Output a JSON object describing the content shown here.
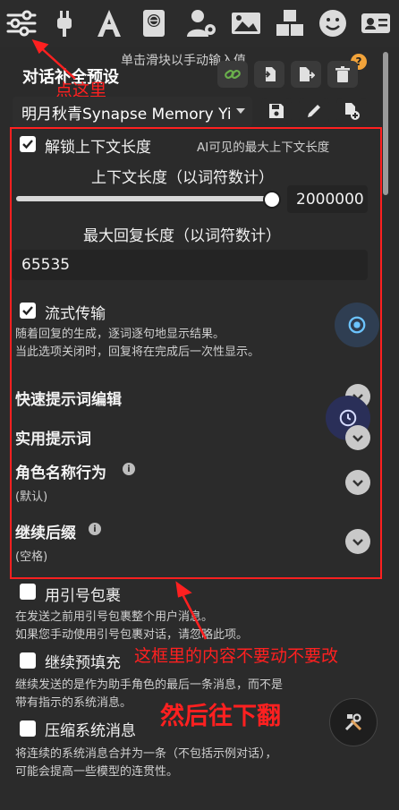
{
  "top_icons": [
    "sliders-icon",
    "plug-icon",
    "font-icon",
    "book-globe-icon",
    "user-gear-icon",
    "image-icon",
    "cubes-icon",
    "smiley-icon",
    "id-card-icon"
  ],
  "hint_text": "单击滑块以手动输入值",
  "preset": {
    "title": "对话补全预设",
    "selected": "明月秋青Synapse Memory Yi"
  },
  "annotations": {
    "click_here": "点这里",
    "box_note": "这框里的内容不要动不要改",
    "scroll_note": "然后往下翻"
  },
  "context": {
    "unlock_label": "解锁上下文长度",
    "unlock_checked": true,
    "ai_visible_label": "AI可见的最大上下文长度",
    "length_label": "上下文长度（以词符数计）",
    "length_value": "2000000",
    "slider_fraction": 1.0,
    "max_reply_label": "最大回复长度（以词符数计）",
    "max_reply_value": "65535"
  },
  "streaming": {
    "label": "流式传输",
    "checked": true,
    "desc1": "随着回复的生成，逐词逐句地显示结果。",
    "desc2": "当此选项关闭时，回复将在完成后一次性显示。"
  },
  "sections": {
    "quick_prompt_edit": "快速提示词编辑",
    "utility_prompts": "实用提示词",
    "char_name_behavior": "角色名称行为",
    "char_name_value": "(默认)",
    "continue_suffix": "继续后缀",
    "continue_suffix_value": "(空格)"
  },
  "options": {
    "wrap_quotes_label": "用引号包裹",
    "wrap_quotes_desc1": "在发送之前用引号包裹整个用户消息。",
    "wrap_quotes_desc2": "如果您手动使用引号包裹对话，请忽略此项。",
    "continue_prefill_label": "继续预填充",
    "continue_prefill_desc1": "继续发送的是作为助手角色的最后一条消息，而不是",
    "continue_prefill_desc2": "带有指示的系统消息。",
    "squash_label": "压缩系统消息",
    "squash_desc1": "将连续的系统消息合并为一条（不包括示例对话），",
    "squash_desc2": "可能会提高一些模型的连贯性。"
  },
  "colors": {
    "annotation_red": "#ff2020",
    "background": "#2b2b2b",
    "accent_link": "#6ab04c"
  }
}
